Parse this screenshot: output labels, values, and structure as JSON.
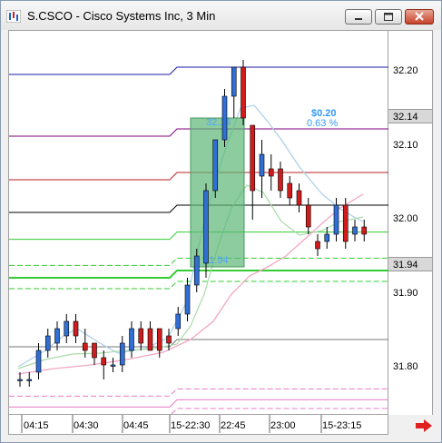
{
  "window": {
    "title": "S.CSCO - Cisco Systems Inc, 3 Min"
  },
  "price_axis": {
    "ticks": [
      "32.20",
      "32.10",
      "32.00",
      "31.90",
      "31.80"
    ],
    "tag_top": "32.14",
    "tag_bottom": "31.94"
  },
  "time_axis": {
    "ticks": [
      "04:15",
      "04:30",
      "04:45",
      "15-22:30",
      "22:45",
      "23:00",
      "15-23:15"
    ]
  },
  "measure": {
    "change": "$0.20",
    "percent": "0.63 %",
    "start_price": "31.94",
    "end_price": "32.14"
  },
  "colors": {
    "up_candle": "#2f6fd6",
    "down_candle": "#d01c1c",
    "measure_fill": "#6dbf86",
    "measure_text": "#3399ff",
    "close_arrow": "#e02020"
  },
  "chart_data": {
    "type": "candlestick",
    "title": "S.CSCO - Cisco Systems Inc, 3 Min",
    "ylim": [
      31.74,
      32.27
    ],
    "grid": false,
    "candles": [
      {
        "o": 31.79,
        "h": 31.8,
        "l": 31.78,
        "c": 31.79
      },
      {
        "o": 31.79,
        "h": 31.8,
        "l": 31.78,
        "c": 31.79
      },
      {
        "o": 31.8,
        "h": 31.84,
        "l": 31.79,
        "c": 31.83
      },
      {
        "o": 31.83,
        "h": 31.86,
        "l": 31.82,
        "c": 31.85
      },
      {
        "o": 31.84,
        "h": 31.87,
        "l": 31.83,
        "c": 31.86
      },
      {
        "o": 31.85,
        "h": 31.88,
        "l": 31.84,
        "c": 31.87
      },
      {
        "o": 31.87,
        "h": 31.88,
        "l": 31.84,
        "c": 31.85
      },
      {
        "o": 31.84,
        "h": 31.86,
        "l": 31.82,
        "c": 31.83
      },
      {
        "o": 31.84,
        "h": 31.84,
        "l": 31.81,
        "c": 31.82
      },
      {
        "o": 31.82,
        "h": 31.83,
        "l": 31.79,
        "c": 31.81
      },
      {
        "o": 31.81,
        "h": 31.82,
        "l": 31.8,
        "c": 31.81
      },
      {
        "o": 31.81,
        "h": 31.85,
        "l": 31.8,
        "c": 31.84
      },
      {
        "o": 31.83,
        "h": 31.87,
        "l": 31.82,
        "c": 31.86
      },
      {
        "o": 31.86,
        "h": 31.87,
        "l": 31.83,
        "c": 31.84
      },
      {
        "o": 31.86,
        "h": 31.87,
        "l": 31.83,
        "c": 31.83
      },
      {
        "o": 31.86,
        "h": 31.86,
        "l": 31.82,
        "c": 31.83
      },
      {
        "o": 31.85,
        "h": 31.86,
        "l": 31.83,
        "c": 31.84
      },
      {
        "o": 31.86,
        "h": 31.89,
        "l": 31.85,
        "c": 31.88
      },
      {
        "o": 31.88,
        "h": 31.93,
        "l": 31.87,
        "c": 31.92
      },
      {
        "o": 31.92,
        "h": 31.97,
        "l": 31.91,
        "c": 31.96
      },
      {
        "o": 31.95,
        "h": 32.06,
        "l": 31.93,
        "c": 32.05
      },
      {
        "o": 32.05,
        "h": 32.12,
        "l": 32.04,
        "c": 32.12
      },
      {
        "o": 32.12,
        "h": 32.19,
        "l": 32.11,
        "c": 32.18
      },
      {
        "o": 32.18,
        "h": 32.22,
        "l": 32.15,
        "c": 32.22
      },
      {
        "o": 32.22,
        "h": 32.23,
        "l": 32.14,
        "c": 32.15
      },
      {
        "o": 32.14,
        "h": 32.14,
        "l": 32.01,
        "c": 32.05
      },
      {
        "o": 32.07,
        "h": 32.12,
        "l": 32.04,
        "c": 32.1
      },
      {
        "o": 32.08,
        "h": 32.1,
        "l": 32.05,
        "c": 32.07
      },
      {
        "o": 32.08,
        "h": 32.09,
        "l": 32.04,
        "c": 32.05
      },
      {
        "o": 32.06,
        "h": 32.07,
        "l": 32.03,
        "c": 32.04
      },
      {
        "o": 32.05,
        "h": 32.06,
        "l": 32.02,
        "c": 32.03
      },
      {
        "o": 32.03,
        "h": 32.04,
        "l": 31.99,
        "c": 32.0
      },
      {
        "o": 31.98,
        "h": 31.99,
        "l": 31.96,
        "c": 31.97
      },
      {
        "o": 31.98,
        "h": 32.0,
        "l": 31.97,
        "c": 31.99
      },
      {
        "o": 31.99,
        "h": 32.04,
        "l": 31.98,
        "c": 32.03
      },
      {
        "o": 32.03,
        "h": 32.04,
        "l": 31.97,
        "c": 31.98
      },
      {
        "o": 31.99,
        "h": 32.01,
        "l": 31.98,
        "c": 32.0
      },
      {
        "o": 32.0,
        "h": 32.01,
        "l": 31.98,
        "c": 31.99
      }
    ],
    "levels": [
      {
        "value": 32.22,
        "color": "#1a1aa8",
        "style": "solid"
      },
      {
        "value": 32.135,
        "color": "#800080",
        "style": "solid"
      },
      {
        "value": 32.075,
        "color": "#b82222",
        "style": "solid"
      },
      {
        "value": 32.03,
        "color": "#000000",
        "style": "solid"
      },
      {
        "value": 31.993,
        "color": "#33cc33",
        "style": "solid"
      },
      {
        "value": 31.957,
        "color": "#33cc33",
        "style": "dashed"
      },
      {
        "value": 31.94,
        "color": "#33cc33",
        "style": "solid"
      },
      {
        "value": 31.925,
        "color": "#33cc33",
        "style": "dashed"
      },
      {
        "value": 31.845,
        "color": "#777777",
        "style": "solid"
      },
      {
        "value": 31.777,
        "color": "#e879c8",
        "style": "dashed"
      },
      {
        "value": 31.762,
        "color": "#e879c8",
        "style": "solid"
      },
      {
        "value": 31.75,
        "color": "#e879c8",
        "style": "dashed"
      }
    ]
  }
}
